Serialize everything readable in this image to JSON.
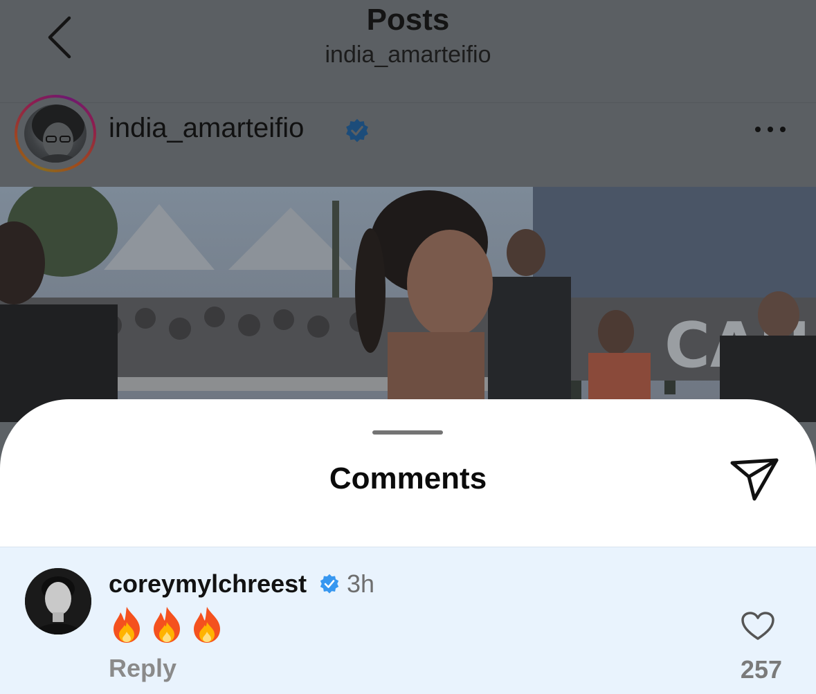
{
  "header": {
    "title": "Posts",
    "subtitle": "india_amarteifio",
    "back_icon": "chevron-left-icon"
  },
  "post": {
    "author": "india_amarteifio",
    "verified": true,
    "more_icon": "more-horizontal-icon"
  },
  "comments_sheet": {
    "title": "Comments",
    "share_icon": "send-icon",
    "comments": [
      {
        "username": "coreymylchreest",
        "verified": true,
        "time": "3h",
        "text": "🔥🔥🔥",
        "reply_label": "Reply",
        "likes": "257",
        "like_icon": "heart-icon"
      }
    ]
  },
  "colors": {
    "dim_overlay": "#5b5f63",
    "verified_badge": "#3797f0",
    "comment_highlight": "#e9f3fd"
  }
}
